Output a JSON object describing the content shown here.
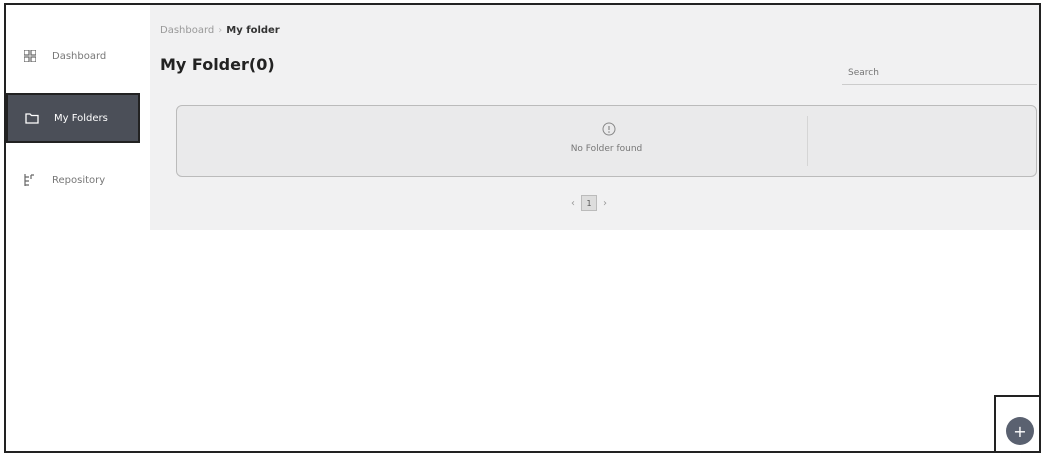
{
  "sidebar": {
    "items": [
      {
        "label": "Dashboard",
        "icon": "dashboard-icon",
        "active": false
      },
      {
        "label": "My Folders",
        "icon": "folder-icon",
        "active": true
      },
      {
        "label": "Repository",
        "icon": "repository-icon",
        "active": false
      }
    ]
  },
  "breadcrumb": {
    "root": "Dashboard",
    "separator": "›",
    "current": "My folder"
  },
  "page": {
    "title": "My Folder(0)"
  },
  "search": {
    "placeholder": "Search"
  },
  "empty_state": {
    "icon": "info-icon",
    "message": "No Folder found"
  },
  "pagination": {
    "prev": "‹",
    "current_page": "1",
    "next": "›"
  },
  "fab": {
    "icon": "plus-icon",
    "label": "+"
  },
  "colors": {
    "sidebar_active_bg": "#4b4f58",
    "fab_bg": "#5a6170",
    "content_bg": "#f1f1f2"
  }
}
